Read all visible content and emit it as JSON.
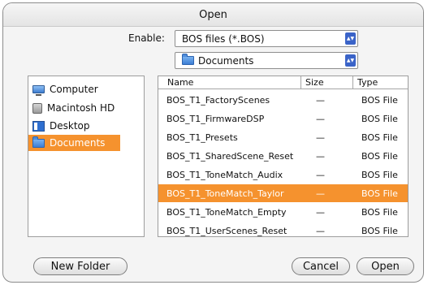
{
  "dialog": {
    "title": "Open"
  },
  "enable": {
    "label": "Enable:",
    "value": "BOS files (*.BOS)"
  },
  "location": {
    "value": "Documents"
  },
  "sidebar": {
    "items": [
      {
        "label": "Computer",
        "icon": "computer-icon",
        "selected": false
      },
      {
        "label": "Macintosh HD",
        "icon": "hard-drive-icon",
        "selected": false
      },
      {
        "label": "Desktop",
        "icon": "desktop-icon",
        "selected": false
      },
      {
        "label": "Documents",
        "icon": "folder-icon",
        "selected": true
      }
    ]
  },
  "filelist": {
    "columns": [
      "Name",
      "Size",
      "Type"
    ],
    "rows": [
      {
        "name": "BOS_T1_FactoryScenes",
        "size": "—",
        "type": "BOS File"
      },
      {
        "name": "BOS_T1_FirmwareDSP",
        "size": "—",
        "type": "BOS File"
      },
      {
        "name": "BOS_T1_Presets",
        "size": "—",
        "type": "BOS File"
      },
      {
        "name": "BOS_T1_SharedScene_Reset",
        "size": "—",
        "type": "BOS File"
      },
      {
        "name": "BOS_T1_ToneMatch_Audix",
        "size": "—",
        "type": "BOS File"
      },
      {
        "name": "BOS_T1_ToneMatch_Taylor",
        "size": "—",
        "type": "BOS File"
      },
      {
        "name": "BOS_T1_ToneMatch_Empty",
        "size": "—",
        "type": "BOS File"
      },
      {
        "name": "BOS_T1_UserScenes_Reset",
        "size": "—",
        "type": "BOS File"
      }
    ],
    "selected_index": 5
  },
  "buttons": {
    "new_folder": "New Folder",
    "cancel": "Cancel",
    "open": "Open"
  },
  "colors": {
    "selection": "#f5922e",
    "popup_arrow": "#3a63c8"
  }
}
